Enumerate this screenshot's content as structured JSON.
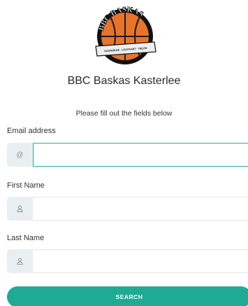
{
  "header": {
    "logo": {
      "arc_text": "BBC BASKAS",
      "banner_text": "KASTERLEE · LICHTAART · TIELEN",
      "colors": {
        "ball": "#e8742a",
        "seams": "#1a1a1a",
        "ring": "#111111",
        "banner": "#eeeeee"
      }
    },
    "org_name": "BBC Baskas Kasterlee"
  },
  "form": {
    "instructions": "Please fill out the fields below",
    "fields": [
      {
        "label": "Email address",
        "value": "",
        "placeholder": "",
        "icon": "at-icon"
      },
      {
        "label": "First Name",
        "value": "",
        "placeholder": "",
        "icon": "user-icon"
      },
      {
        "label": "Last Name",
        "value": "",
        "placeholder": "",
        "icon": "user-icon"
      }
    ],
    "search_label": "Search",
    "icon_glyphs": {
      "at": "@"
    }
  },
  "colors": {
    "accent": "#1faa95",
    "focus_border": "#27ac9a",
    "addon_bg": "#e9eef0"
  }
}
